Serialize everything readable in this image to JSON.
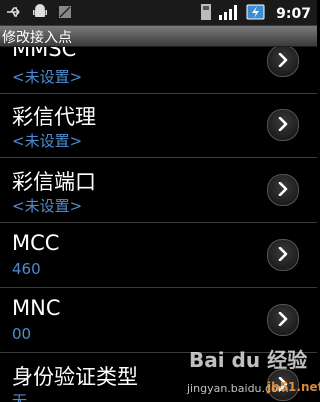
{
  "status_bar": {
    "time": "9:07",
    "icons": [
      "usb-icon",
      "android-debug-icon",
      "no-sim-icon",
      "sd-card-icon",
      "signal-icon",
      "battery-charging-icon"
    ]
  },
  "title": "修改接入点",
  "items": [
    {
      "label": "MMSC",
      "value": "<未设置>"
    },
    {
      "label": "彩信代理",
      "value": "<未设置>"
    },
    {
      "label": "彩信端口",
      "value": "<未设置>"
    },
    {
      "label": "MCC",
      "value": "460"
    },
    {
      "label": "MNC",
      "value": "00"
    },
    {
      "label": "身份验证类型",
      "value": "无"
    }
  ],
  "watermark": {
    "brand": "Bai du 经验",
    "url": "jingyan.baidu.com",
    "site": "jb51.net"
  },
  "colors": {
    "value_text": "#4f8ccf",
    "background": "#000000",
    "title_bar": "#5a5a5a"
  }
}
